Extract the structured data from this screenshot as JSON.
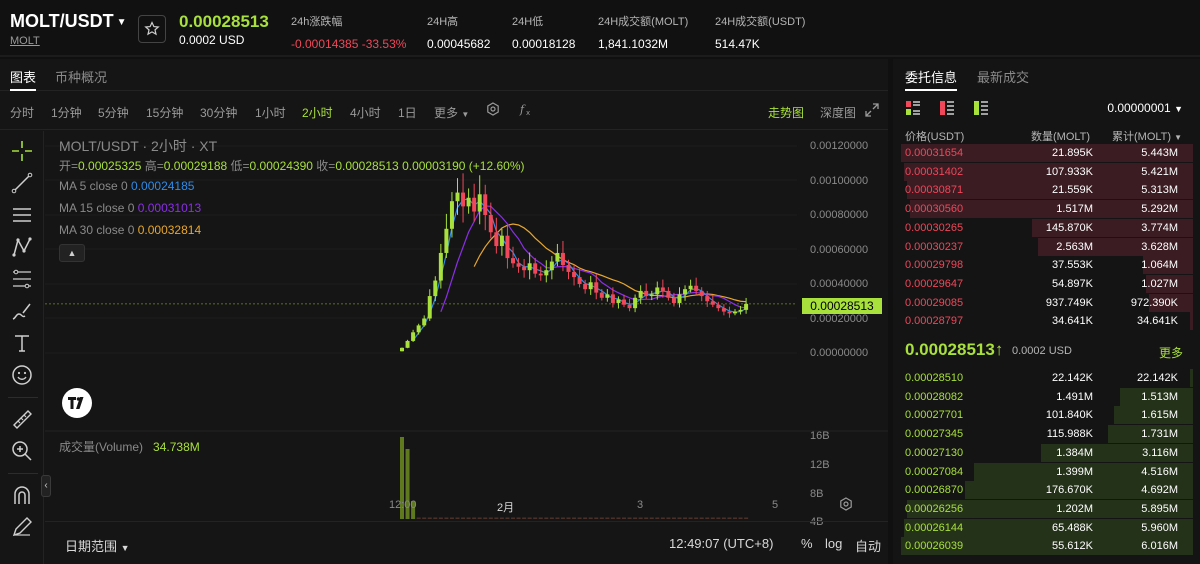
{
  "header": {
    "pair": "MOLT/USDT",
    "pair_sub": "MOLT",
    "price": "0.00028513",
    "price_usd": "0.0002 USD",
    "stats": [
      {
        "label": "24h涨跌幅",
        "value": "-0.00014385 -33.53%",
        "negative": true
      },
      {
        "label": "24H高",
        "value": "0.00045682"
      },
      {
        "label": "24H低",
        "value": "0.00018128"
      },
      {
        "label": "24H成交额(MOLT)",
        "value": "1,841.1032M"
      },
      {
        "label": "24H成交额(USDT)",
        "value": "514.47K"
      }
    ]
  },
  "chart_tabs": [
    "图表",
    "币种概况"
  ],
  "timeframes": [
    "分时",
    "1分钟",
    "5分钟",
    "15分钟",
    "30分钟",
    "1小时",
    "2小时",
    "4小时",
    "1日",
    "更多"
  ],
  "active_timeframe": "2小时",
  "chart_modes": {
    "trend": "走势图",
    "depth": "深度图"
  },
  "legend": {
    "title": "MOLT/USDT · 2小时 · XT",
    "open_label": "开=",
    "open": "0.00025325",
    "high_label": "高=",
    "high": "0.00029188",
    "low_label": "低=",
    "low": "0.00024390",
    "close_label": "收=",
    "close": "0.00028513",
    "change": "0.00003190 (+12.60%)",
    "ma5_label": "MA 5 close 0",
    "ma5": "0.00024185",
    "ma15_label": "MA 15 close 0",
    "ma15": "0.00031013",
    "ma30_label": "MA 30 close 0",
    "ma30": "0.00032814",
    "volume_label": "成交量(Volume)",
    "volume": "34.738M"
  },
  "colors": {
    "up": "#a8e03c",
    "down": "#f0475a",
    "ma5": "#2f8ce8",
    "ma15": "#8b2fe8",
    "ma30": "#e8a72f"
  },
  "price_axis": [
    "0.00120000",
    "0.00100000",
    "0.00080000",
    "0.00060000",
    "0.00040000",
    "0.00020000",
    "0.00000000"
  ],
  "last_price_tag": "0.00028513",
  "volume_axis": [
    "16B",
    "12B",
    "8B",
    "4B"
  ],
  "time_axis": [
    "12:00",
    "2月",
    "3",
    "5"
  ],
  "bottom_bar": {
    "date_range": "日期范围",
    "clock": "12:49:07 (UTC+8)",
    "pct": "%",
    "log": "log",
    "auto": "自动"
  },
  "orderbook": {
    "tabs": [
      "委托信息",
      "最新成交"
    ],
    "precision": "0.00000001",
    "headers": [
      "价格(USDT)",
      "数量(MOLT)",
      "累计(MOLT)"
    ],
    "asks": [
      {
        "price": "0.00031654",
        "qty": "21.895K",
        "total": "5.443M",
        "depth": 1.0
      },
      {
        "price": "0.00031402",
        "qty": "107.933K",
        "total": "5.421M",
        "depth": 0.99
      },
      {
        "price": "0.00030871",
        "qty": "21.559K",
        "total": "5.313M",
        "depth": 0.98
      },
      {
        "price": "0.00030560",
        "qty": "1.517M",
        "total": "5.292M",
        "depth": 0.97
      },
      {
        "price": "0.00030265",
        "qty": "145.870K",
        "total": "3.774M",
        "depth": 0.55
      },
      {
        "price": "0.00030237",
        "qty": "2.563M",
        "total": "3.628M",
        "depth": 0.53
      },
      {
        "price": "0.00029798",
        "qty": "37.553K",
        "total": "1.064M",
        "depth": 0.17
      },
      {
        "price": "0.00029647",
        "qty": "54.897K",
        "total": "1.027M",
        "depth": 0.16
      },
      {
        "price": "0.00029085",
        "qty": "937.749K",
        "total": "972.390K",
        "depth": 0.15
      },
      {
        "price": "0.00028797",
        "qty": "34.641K",
        "total": "34.641K",
        "depth": 0.01
      }
    ],
    "mid_price": "0.00028513",
    "mid_arrow": "↑",
    "mid_usd": "0.0002 USD",
    "more": "更多",
    "bids": [
      {
        "price": "0.00028510",
        "qty": "22.142K",
        "total": "22.142K",
        "depth": 0.01
      },
      {
        "price": "0.00028082",
        "qty": "1.491M",
        "total": "1.513M",
        "depth": 0.25
      },
      {
        "price": "0.00027701",
        "qty": "101.840K",
        "total": "1.615M",
        "depth": 0.27
      },
      {
        "price": "0.00027345",
        "qty": "115.988K",
        "total": "1.731M",
        "depth": 0.29
      },
      {
        "price": "0.00027130",
        "qty": "1.384M",
        "total": "3.116M",
        "depth": 0.52
      },
      {
        "price": "0.00027084",
        "qty": "1.399M",
        "total": "4.516M",
        "depth": 0.75
      },
      {
        "price": "0.00026870",
        "qty": "176.670K",
        "total": "4.692M",
        "depth": 0.78
      },
      {
        "price": "0.00026256",
        "qty": "1.202M",
        "total": "5.895M",
        "depth": 0.98
      },
      {
        "price": "0.00026144",
        "qty": "65.488K",
        "total": "5.960M",
        "depth": 0.99
      },
      {
        "price": "0.00026039",
        "qty": "55.612K",
        "total": "6.016M",
        "depth": 1.0
      }
    ]
  }
}
